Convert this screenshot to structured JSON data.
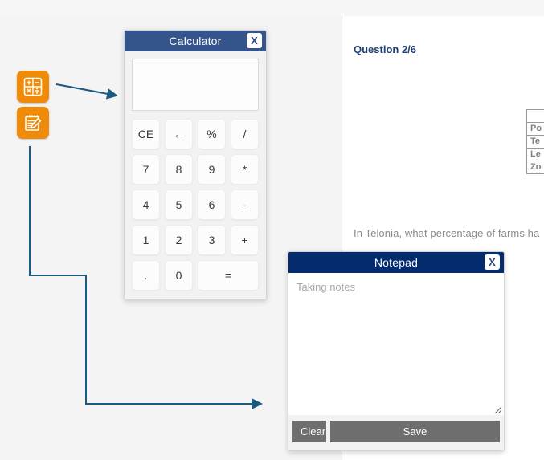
{
  "background_color": "#f4f4f4",
  "accent_colors": {
    "launcher_orange": "#ef8b09",
    "calculator_header": "#35548c",
    "notepad_header": "#042b6e",
    "arrow_blue": "#1a5a7f",
    "question_title_navy": "#1d3f73",
    "button_gray": "#6e6e6e"
  },
  "launchers": [
    {
      "name": "calculator-launcher",
      "icon": "calculator-icon",
      "symbols": [
        "+",
        "−",
        "×",
        "÷"
      ]
    },
    {
      "name": "notepad-launcher",
      "icon": "notepad-pencil-icon"
    }
  ],
  "calculator": {
    "title": "Calculator",
    "close_label": "X",
    "display_value": "",
    "keys": [
      "CE",
      "←",
      "%",
      "/",
      "7",
      "8",
      "9",
      "*",
      "4",
      "5",
      "6",
      "-",
      "1",
      "2",
      "3",
      "+",
      ".",
      "0",
      "="
    ]
  },
  "notepad": {
    "title": "Notepad",
    "close_label": "X",
    "placeholder": "Taking notes",
    "value": "",
    "clear_label": "Clear",
    "save_label": "Save"
  },
  "question_panel": {
    "title": "Question 2/6",
    "text": "In Telonia, what percentage of farms ha",
    "table": {
      "header": [
        "",
        ""
      ],
      "rows": [
        [
          "Po",
          ""
        ],
        [
          "Te",
          ""
        ],
        [
          "Le",
          ""
        ],
        [
          "Zo",
          ""
        ]
      ]
    }
  }
}
